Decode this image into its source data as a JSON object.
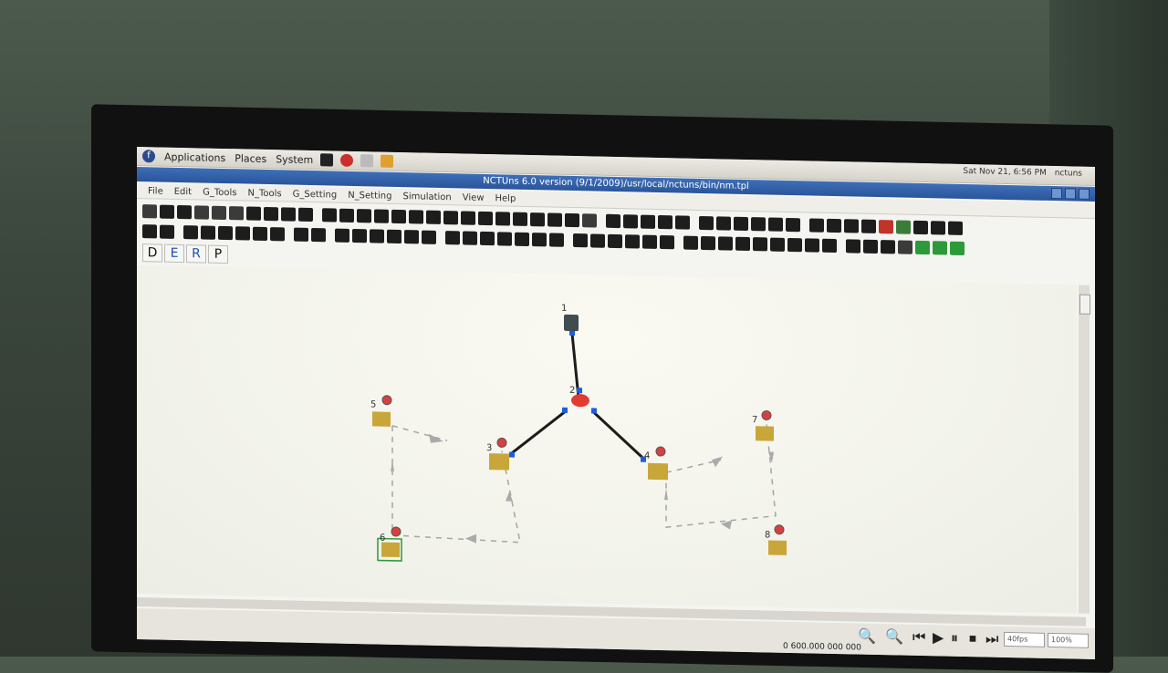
{
  "panel": {
    "applications": "Applications",
    "places": "Places",
    "system": "System",
    "clock": "Sat Nov 21,  6:56 PM",
    "user": "nctuns"
  },
  "window": {
    "title": "NCTUns 6.0 version (9/1/2009)/usr/local/nctuns/bin/nm.tpl"
  },
  "menu": {
    "items": [
      "File",
      "Edit",
      "G_Tools",
      "N_Tools",
      "G_Setting",
      "N_Setting",
      "Simulation",
      "View",
      "Help"
    ]
  },
  "modes": [
    "D",
    "E",
    "R",
    "P"
  ],
  "nodes": [
    {
      "id": "1",
      "type": "host"
    },
    {
      "id": "2",
      "type": "router"
    },
    {
      "id": "3",
      "type": "access-point"
    },
    {
      "id": "4",
      "type": "access-point"
    },
    {
      "id": "5",
      "type": "mobile-node"
    },
    {
      "id": "6",
      "type": "mobile-node"
    },
    {
      "id": "7",
      "type": "mobile-node"
    },
    {
      "id": "8",
      "type": "mobile-node"
    }
  ],
  "status": {
    "sim_time": "0 600.000 000 000",
    "speed": "40fps",
    "zoom": "100%"
  },
  "colors": {
    "titlebar": "#2a559a",
    "router": "#e23b2f",
    "link": "#1c1c1c",
    "link_endpoint": "#1d5ee0",
    "ap": "#c9a63a"
  }
}
